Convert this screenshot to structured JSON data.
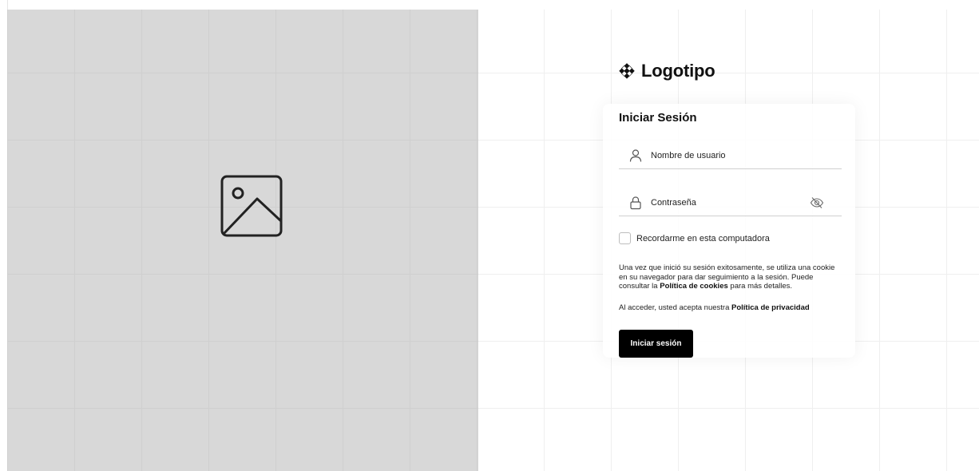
{
  "image_panel": {
    "icon": "image-placeholder-icon"
  },
  "logo": {
    "icon": "checker-diamond-icon",
    "text": "Logotipo"
  },
  "form": {
    "title": "Iniciar Sesión",
    "username": {
      "icon": "user-icon",
      "placeholder": "Nombre de usuario",
      "value": ""
    },
    "password": {
      "icon": "lock-icon",
      "placeholder": "Contraseña",
      "value": "",
      "toggle_icon": "eye-off-icon"
    },
    "remember_label": "Recordarme en esta computadora",
    "cookie_notice": {
      "before": "Una vez que inició su sesión exitosamente, se utiliza una cookie en su navegador para dar seguimiento a la sesión. Puede consultar la ",
      "link": "Política de cookies",
      "after": " para más detalles."
    },
    "privacy_notice": {
      "before": "Al acceder, usted acepta nuestra ",
      "link": "Política de privacidad"
    },
    "submit_label": "Iniciar sesión"
  },
  "colors": {
    "panel": "#d8d8d8",
    "button": "#000000",
    "text": "#111111"
  }
}
